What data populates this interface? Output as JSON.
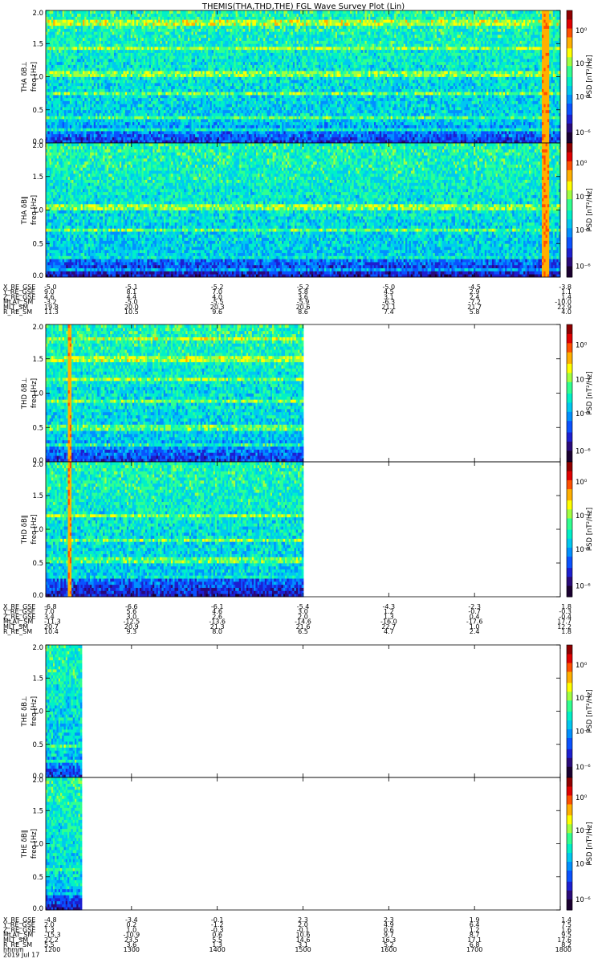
{
  "title": "THEMIS(THA,THD,THE) FGL Wave Survey Plot (Lin)",
  "colors": {
    "colormap": [
      "#1a0030",
      "#2a0a7a",
      "#1d1fd0",
      "#0a52ff",
      "#0090ff",
      "#00c8f0",
      "#00f0c8",
      "#30ff90",
      "#a0ff40",
      "#ffff00",
      "#ffb000",
      "#ff5000",
      "#e00000",
      "#900000"
    ]
  },
  "yticks": [
    "0.0",
    "0.5",
    "1.0",
    "1.5",
    "2.0"
  ],
  "colorbar_label": "PSD [nT²/Hz]",
  "colorbar_ticks": [
    "10⁰",
    "10⁻²",
    "10⁻⁴",
    "10⁻⁶"
  ],
  "time_labels": [
    "hhmm",
    "2019 Jul 17"
  ],
  "final_time_ticks": [
    "1200",
    "1300",
    "1400",
    "1500",
    "1600",
    "1700",
    "1800"
  ],
  "chart_data": [
    {
      "type": "heatmap",
      "probe": "THA",
      "panels": [
        {
          "ylabel": "THA δB⊥",
          "ylabel2": "freq [Hz]",
          "ylim": [
            0,
            2.0
          ],
          "data_extent": 1.0,
          "bands": [
            0.2,
            0.38,
            0.75,
            1.05,
            1.42,
            1.82
          ],
          "spike": 0.97
        },
        {
          "ylabel": "THA δB∥",
          "ylabel2": "freq [Hz]",
          "ylim": [
            0,
            2.0
          ],
          "data_extent": 1.0,
          "bands": [
            0.12,
            0.28,
            0.72,
            1.05
          ],
          "spike": 0.97
        }
      ],
      "ephemeris": {
        "labels": [
          "X_RE_GSE",
          "Y_RE_GSE",
          "Z_RE_GSE",
          "MLAT_SM",
          "MLT_SM",
          "R_RE_SM"
        ],
        "rows": [
          [
            "-5.0",
            "-5.1",
            "-5.2",
            "-5.2",
            "-5.0",
            "-4.5",
            "-3.8"
          ],
          [
            "9.0",
            "8.1",
            "7.0",
            "5.8",
            "4.5",
            "2.9",
            "1.1"
          ],
          [
            "4.6",
            "4.4",
            "4.0",
            "3.6",
            "3.1",
            "2.4",
            "1.4"
          ],
          [
            "-3.2",
            "-5.0",
            "-5.5",
            "-5.9",
            "-6.3",
            "-7.2",
            "-10.0"
          ],
          [
            "19.8",
            "20.0",
            "20.3",
            "20.6",
            "21.1",
            "21.7",
            "22.9"
          ],
          [
            "11.3",
            "10.5",
            "9.6",
            "8.6",
            "7.4",
            "5.8",
            "4.0"
          ]
        ]
      }
    },
    {
      "type": "heatmap",
      "probe": "THD",
      "panels": [
        {
          "ylabel": "THD δB⊥",
          "ylabel2": "freq [Hz]",
          "ylim": [
            0,
            2.0
          ],
          "data_extent": 0.5,
          "bands": [
            0.25,
            0.5,
            0.9,
            1.2,
            1.5,
            1.8
          ],
          "spike": 0.09
        },
        {
          "ylabel": "THD δB∥",
          "ylabel2": "freq [Hz]",
          "ylim": [
            0,
            2.0
          ],
          "data_extent": 0.5,
          "bands": [
            0.28,
            0.55,
            0.85,
            1.2
          ],
          "spike": 0.09
        }
      ],
      "ephemeris": {
        "labels": [
          "X_RE_GSE",
          "Y_RE_GSE",
          "Z_RE_GSE",
          "MLAT_SM",
          "MLT_SM",
          "R_RE_SM"
        ],
        "rows": [
          [
            "-6.8",
            "-6.6",
            "-6.1",
            "-5.4",
            "-4.3",
            "-2.3",
            "1.8"
          ],
          [
            "7.0",
            "5.6",
            "4.6",
            "3.0",
            "1.2",
            "-0.7",
            "-0.3"
          ],
          [
            "3.4",
            "3.0",
            "2.6",
            "2.0",
            "1.3",
            "0.4",
            "-0.4"
          ],
          [
            "-11.3",
            "-12.5",
            "-13.6",
            "-14.6",
            "-16.0",
            "-17.6",
            "17.7"
          ],
          [
            "20.7",
            "20.9",
            "21.3",
            "21.6",
            "22.7",
            "1.0",
            "12.2"
          ],
          [
            "10.4",
            "9.3",
            "8.0",
            "6.5",
            "4.7",
            "2.4",
            "1.8"
          ]
        ]
      }
    },
    {
      "type": "heatmap",
      "probe": "THE",
      "panels": [
        {
          "ylabel": "THE δB⊥",
          "ylabel2": "freq [Hz]",
          "ylim": [
            0,
            2.0
          ],
          "data_extent": 0.07,
          "bands": [
            0.25,
            0.48
          ],
          "spike": null
        },
        {
          "ylabel": "THE δB∥",
          "ylabel2": "freq [Hz]",
          "ylim": [
            0,
            2.0
          ],
          "data_extent": 0.07,
          "bands": [
            0.25,
            0.6
          ],
          "spike": null
        }
      ],
      "ephemeris": {
        "labels": [
          "X_RE_GSE",
          "Y_RE_GSE",
          "Z_RE_GSE",
          "MLAT_SM",
          "MLT_SM",
          "R_RE_SM"
        ],
        "rows": [
          [
            "-4.8",
            "-3.4",
            "-0.1",
            "2.3",
            "2.3",
            "1.9",
            "1.4"
          ],
          [
            "2.0",
            "0.2",
            "-1.2",
            "2.0",
            "4.9",
            "6.4",
            "7.5"
          ],
          [
            "1.3",
            "1.0",
            "-0.3",
            "-0.1",
            "0.6",
            "1.2",
            "1.6"
          ],
          [
            "-15.3",
            "-10.9",
            "0.6",
            "10.6",
            "9.7",
            "8.7",
            "9.5"
          ],
          [
            "22.2",
            "23.5",
            "5.5",
            "14.6",
            "16.3",
            "17.1",
            "17.6"
          ],
          [
            "5.5",
            "3.6",
            "1.3",
            "3.1",
            "5.2",
            "6.8",
            "8.2"
          ]
        ]
      }
    }
  ]
}
